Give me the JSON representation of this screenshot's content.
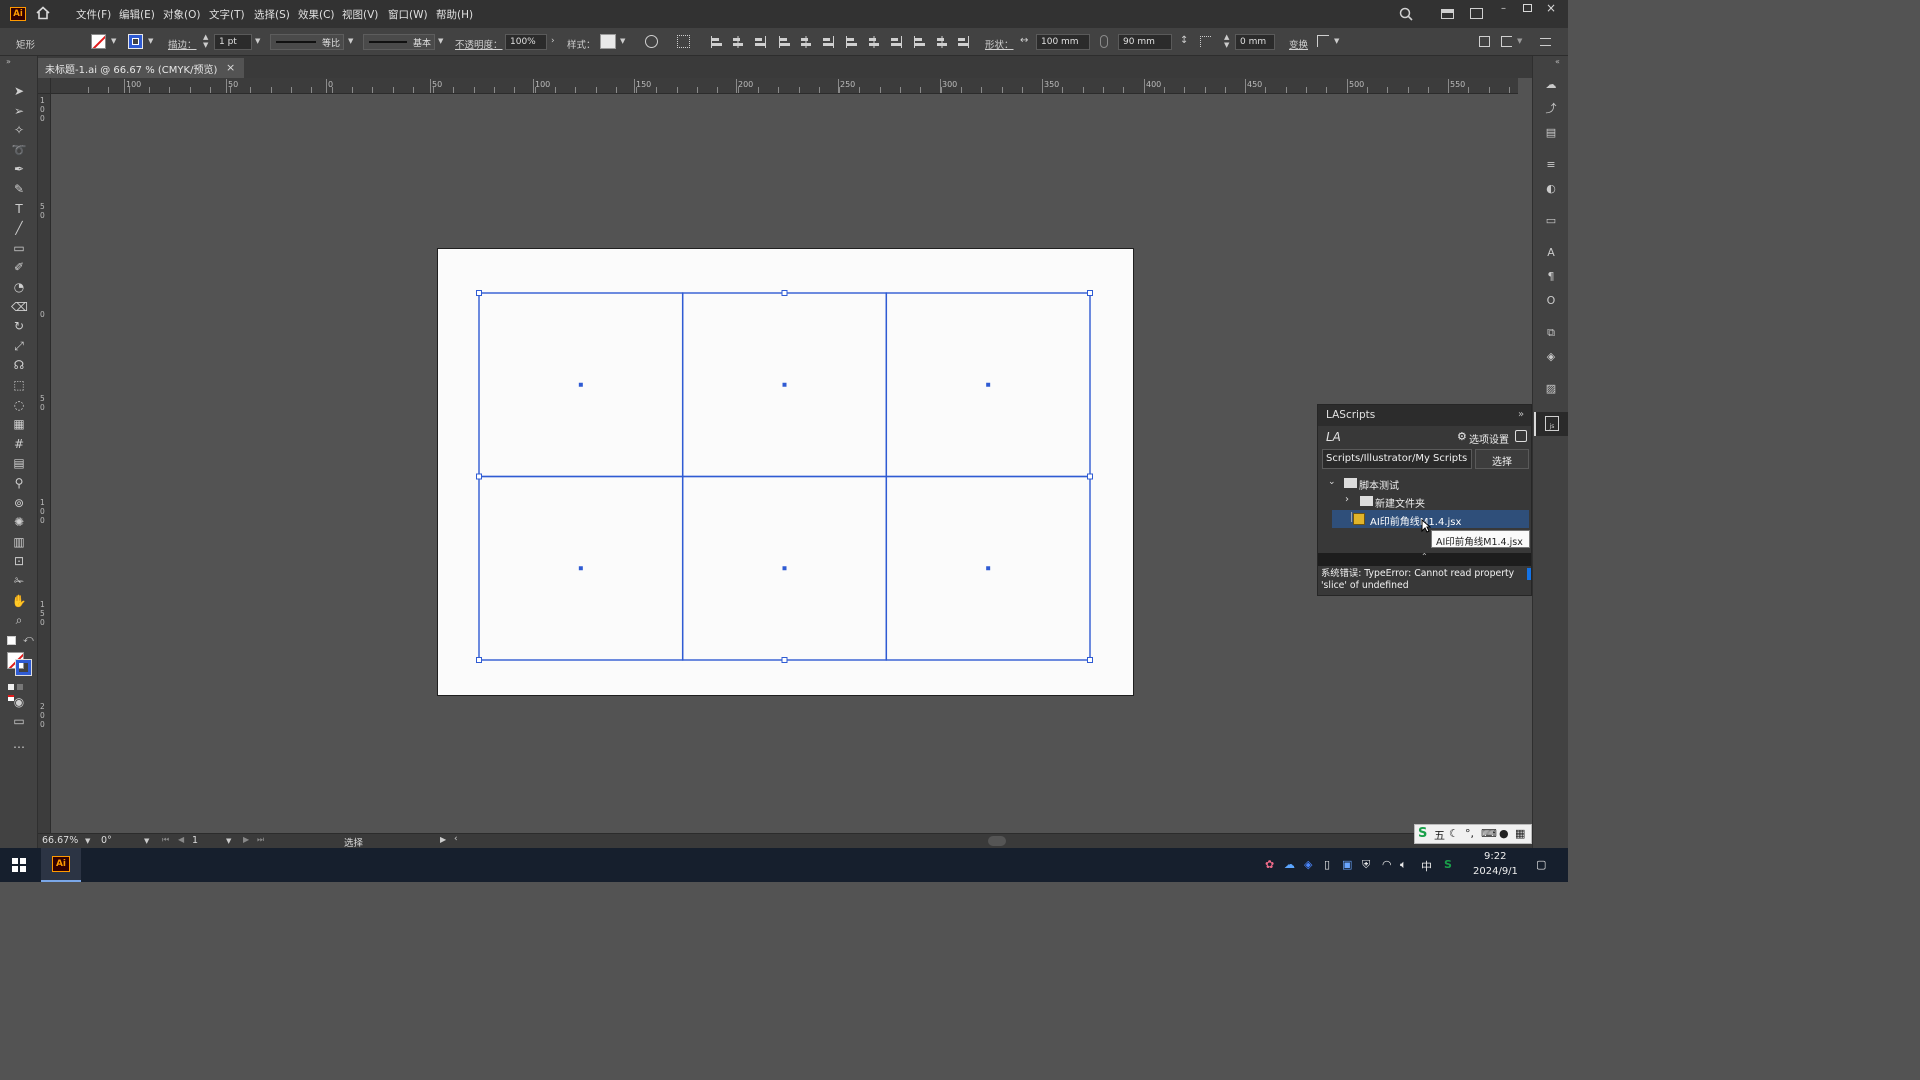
{
  "app": {
    "logo": "Ai",
    "menus": [
      "文件(F)",
      "编辑(E)",
      "对象(O)",
      "文字(T)",
      "选择(S)",
      "效果(C)",
      "视图(V)",
      "窗口(W)",
      "帮助(H)"
    ]
  },
  "control_bar": {
    "object_type": "矩形",
    "stroke_label": "描边：",
    "stroke_weight": "1 pt",
    "profile": "等比",
    "brush": "基本",
    "opacity_label": "不透明度：",
    "opacity_value": "100%",
    "style_label": "样式：",
    "shape_label": "形状：",
    "width_value": "100 mm",
    "height_value": "90 mm",
    "corner_value": "0 mm",
    "transform_label": "变换"
  },
  "document": {
    "tab_title": "未标题-1.ai @ 66.67 % (CMYK/预览)",
    "tab_close": "×"
  },
  "ruler": {
    "top_labels": [
      "100",
      "50",
      "0",
      "50",
      "100",
      "150",
      "200",
      "250",
      "300",
      "350",
      "400",
      "450",
      "500",
      "550"
    ],
    "left_labels": [
      "1 0 0",
      "5 0",
      "0",
      "5 0",
      "1 0 0",
      "1 5 0",
      "2 0 0"
    ]
  },
  "canvas": {
    "grid_rows": 2,
    "grid_cols": 3,
    "selection_color": "#2f5bd3"
  },
  "scripts_panel": {
    "title": "LAScripts",
    "logo": "LA",
    "settings_label": "选项设置",
    "path_value": "Scripts/Illustrator/My Scripts",
    "select_button": "选择",
    "tree": [
      {
        "label": "脚本测试",
        "level": 0,
        "expanded": true
      },
      {
        "label": "新建文件夹",
        "level": 1,
        "expanded": false
      },
      {
        "label": "AI印前角线M1.4.jsx",
        "level": 1,
        "selected": true
      }
    ],
    "tooltip": "AI印前角线M1.4.jsx",
    "error_text": "系统错误: TypeError: Cannot read property 'slice' of undefined"
  },
  "status_bar": {
    "zoom": "66.67%",
    "rotation": "0°",
    "artboard_number": "1",
    "tool_name": "选择"
  },
  "taskbar": {
    "app_badge": "Ai",
    "ime_wubi": "五",
    "input_lang": "中",
    "time": "9:22",
    "date": "2024/9/1"
  },
  "colors": {
    "accent": "#2f5bd3",
    "panel_selected": "#2f4f7a",
    "menubar": "#323232",
    "canvas_bg": "#535353"
  }
}
